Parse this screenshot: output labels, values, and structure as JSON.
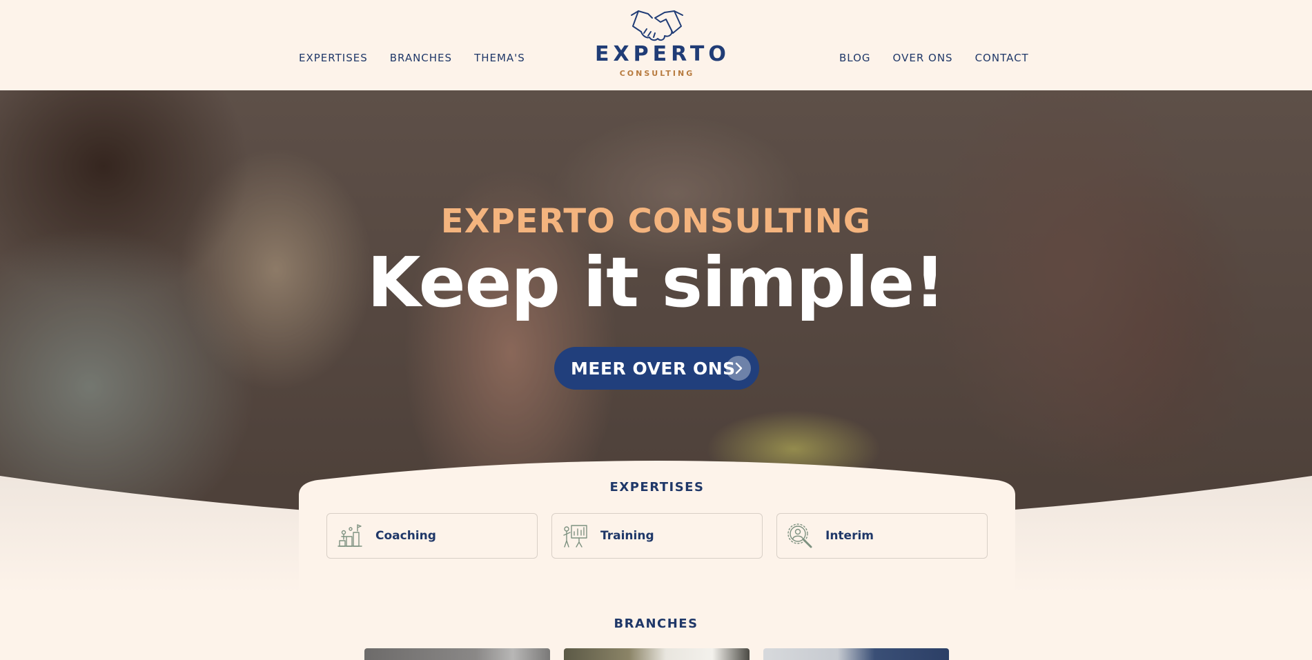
{
  "header": {
    "nav_left": [
      "EXPERTISES",
      "BRANCHES",
      "THEMA'S"
    ],
    "nav_right": [
      "BLOG",
      "OVER ONS",
      "CONTACT"
    ],
    "logo": {
      "title": "EXPERTO",
      "subtitle": "CONSULTING",
      "icon": "handshake-icon"
    }
  },
  "hero": {
    "eyebrow": "EXPERTO CONSULTING",
    "title": "Keep it simple!",
    "cta_label": "MEER OVER ONS",
    "cta_icon": "chevron-right-icon"
  },
  "expertises": {
    "title": "EXPERTISES",
    "cards": [
      {
        "label": "Coaching",
        "icon": "coaching-icon"
      },
      {
        "label": "Training",
        "icon": "presentation-icon"
      },
      {
        "label": "Interim",
        "icon": "person-search-icon"
      }
    ]
  },
  "branches": {
    "title": "BRANCHES"
  },
  "colors": {
    "background": "#fdf3ea",
    "navy": "#1f3768",
    "accent_orange": "#f4b47e",
    "button": "#213f7c",
    "logo_sub": "#b77a3e"
  }
}
